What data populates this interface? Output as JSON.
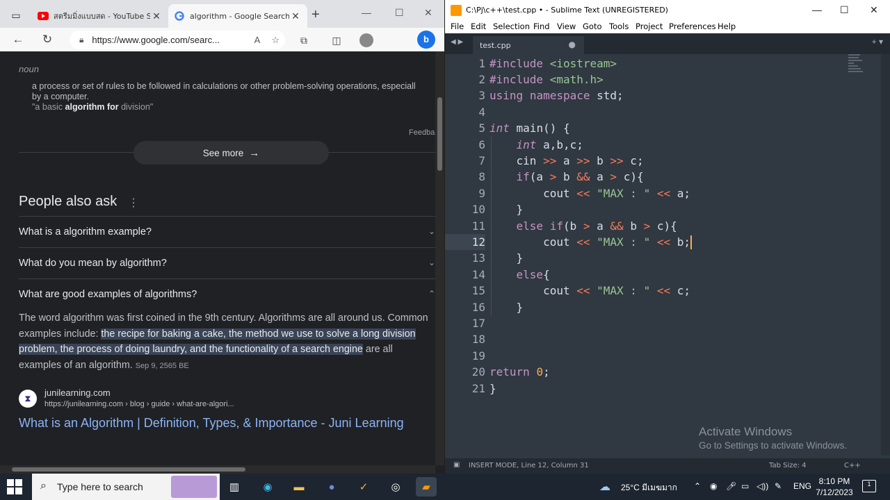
{
  "browser": {
    "tabs": [
      {
        "title": "สตรีมมิ่งแบบสด - YouTube Stu",
        "icon": "youtube-icon"
      },
      {
        "title": "algorithm - Google Search",
        "icon": "google-icon"
      }
    ],
    "url": "https://www.google.com/searc...",
    "definition": {
      "pos": "noun",
      "text_line1": "a process or set of rules to be followed in calculations or other problem-solving operations, especiall",
      "text_line2": "by a computer.",
      "example_pre": "\"a basic ",
      "example_bold": "algorithm for",
      "example_post": " division\"",
      "feedback": "Feedba"
    },
    "see_more": "See more",
    "people_also_ask": {
      "title": "People also ask",
      "questions": [
        "What is a algorithm example?",
        "What do you mean by algorithm?",
        "What are good examples of algorithms?"
      ],
      "answer_plain": "The word algorithm was first coined in the 9th century. Algorithms are all around us. Common examples include: ",
      "answer_highlight": "the recipe for baking a cake, the method we use to solve a long division problem, the process of doing laundry, and the functionality of a search engine",
      "answer_tail": " are all examples of an algorithm.",
      "answer_date": "Sep 9, 2565 BE"
    },
    "result": {
      "site_name": "junilearning.com",
      "site_url": "https://junilearning.com › blog › guide › what-are-algori...",
      "title": "What is an Algorithm | Definition, Types, & Importance - Juni Learning"
    }
  },
  "sublime": {
    "window_title": "C:\\Pj\\c++\\test.cpp • - Sublime Text (UNREGISTERED)",
    "menu": [
      "File",
      "Edit",
      "Selection",
      "Find",
      "View",
      "Goto",
      "Tools",
      "Project",
      "Preferences",
      "Help"
    ],
    "tab_name": "test.cpp",
    "current_line": 12,
    "lines": [
      "#include <iostream>",
      "#include <math.h>",
      "using namespace std;",
      "",
      "int main() {",
      "    int a,b,c;",
      "    cin >> a >> b >> c;",
      "    if(a > b && a > c){",
      "        cout << \"MAX : \" << a;",
      "    }",
      "    else if(b > a && b > c){",
      "        cout << \"MAX : \" << b;",
      "    }",
      "    else{",
      "        cout << \"MAX : \" << c;",
      "    }",
      "",
      "",
      "",
      "return 0;",
      "}"
    ],
    "watermark_title": "Activate Windows",
    "watermark_sub": "Go to Settings to activate Windows.",
    "status_left": "INSERT MODE, Line 12, Column 31",
    "tab_size": "Tab Size: 4",
    "syntax": "C++"
  },
  "taskbar": {
    "search_placeholder": "Type here to search",
    "weather": "25°C  มีเมฆมาก",
    "lang": "ENG",
    "time": "8:10 PM",
    "date": "7/12/2023"
  },
  "colors": {
    "keyword": "#c594c5",
    "string": "#99c794",
    "operator": "#f97b58",
    "number": "#f9ae58",
    "type": "#c594c5",
    "plain": "#d8dee9",
    "link": "#8ab4f8"
  }
}
